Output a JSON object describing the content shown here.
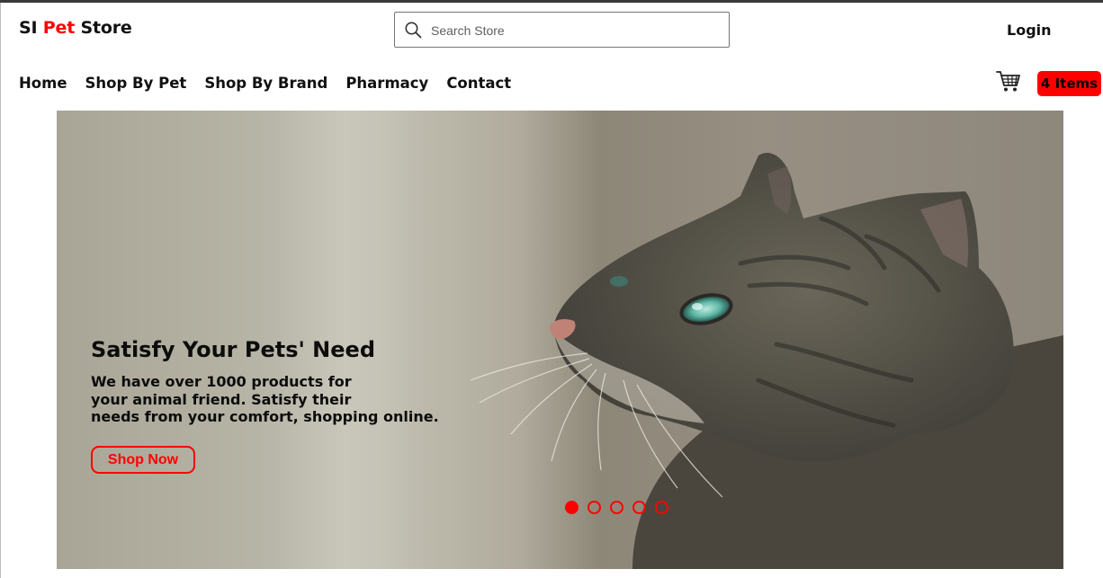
{
  "header": {
    "logo": {
      "part1": "SI ",
      "part2": "Pet",
      "part3": " Store"
    },
    "search": {
      "placeholder": "Search Store",
      "value": ""
    },
    "login_label": "Login"
  },
  "nav": {
    "items": [
      {
        "label": "Home"
      },
      {
        "label": "Shop By Pet"
      },
      {
        "label": "Shop By Brand"
      },
      {
        "label": "Pharmacy"
      },
      {
        "label": "Contact"
      }
    ],
    "cart_icon": "cart-icon",
    "cart_badge": "4 Items"
  },
  "hero": {
    "title": "Satisfy Your Pets' Need",
    "text_lines": [
      "We have over 1000 products for",
      "your animal friend. Satisfy their",
      "needs from your comfort, shopping online."
    ],
    "button_label": "Shop Now",
    "image": "tabby-cat-photo",
    "carousel": {
      "count": 5,
      "active_index": 0
    }
  },
  "colors": {
    "accent": "#ff0000",
    "text": "#111111",
    "background": "#ffffff"
  }
}
